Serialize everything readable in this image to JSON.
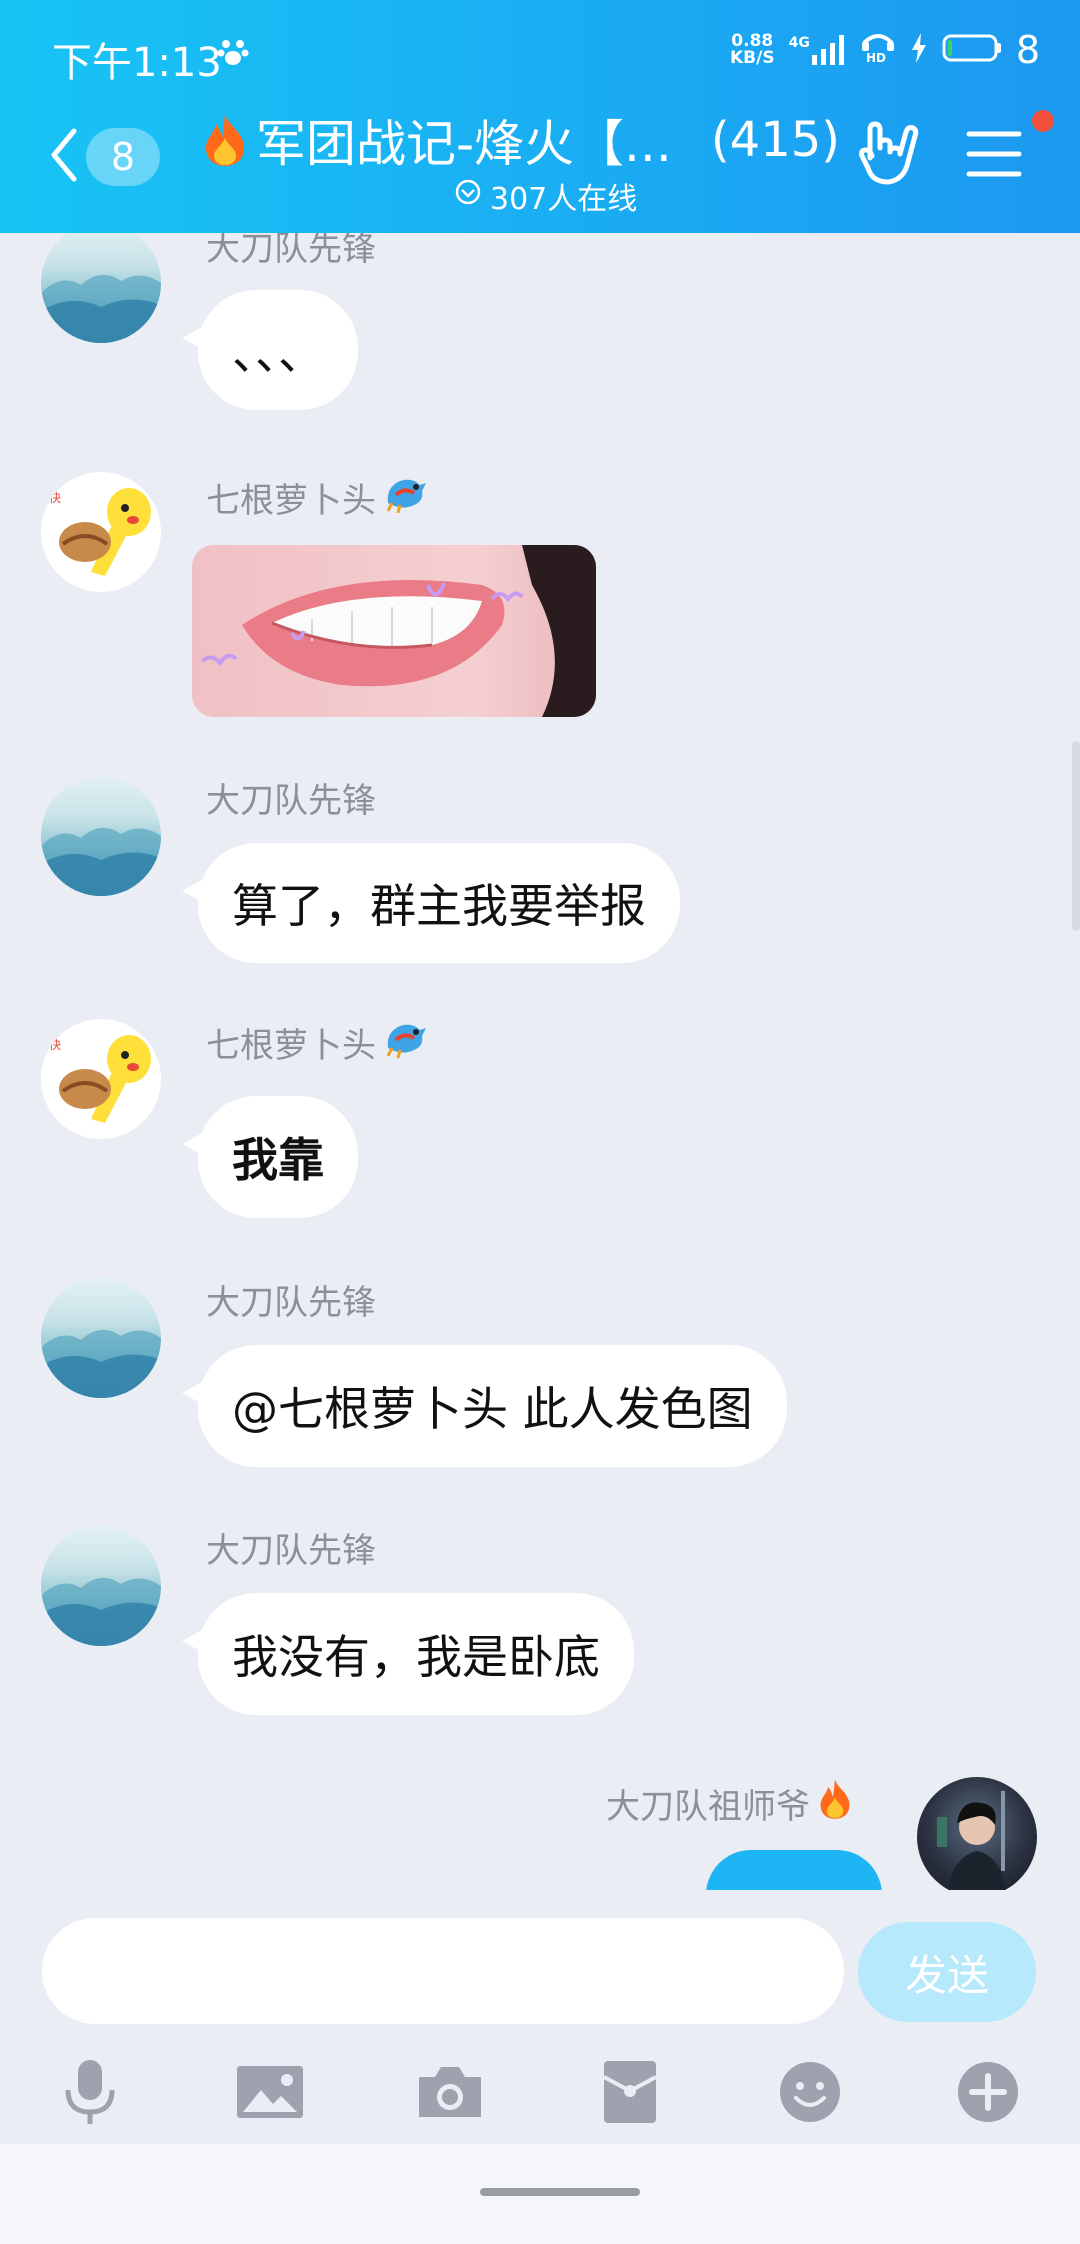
{
  "status_bar": {
    "time": "下午1:13",
    "net_speed_value": "0.88",
    "net_speed_unit": "KB/S",
    "network": "4G",
    "battery": "8"
  },
  "header": {
    "unread_count": "8",
    "group_title": "军团战记-烽火【...",
    "member_count": "(415)",
    "online_text": "307人在线"
  },
  "messages": [
    {
      "sender": "大刀队先锋",
      "text": "、、、"
    },
    {
      "sender": "七根萝卜头",
      "type": "image"
    },
    {
      "sender": "大刀队先锋",
      "text": "算了，群主我要举报"
    },
    {
      "sender": "七根萝卜头",
      "text": "我靠"
    },
    {
      "sender": "大刀队先锋",
      "text": "@七根萝卜头 此人发色图"
    },
    {
      "sender": "大刀队先锋",
      "text": "我没有，我是卧底"
    },
    {
      "sender": "大刀队祖师爷",
      "text": "、"
    }
  ],
  "input": {
    "placeholder": "",
    "send_label": "发送"
  },
  "icons": {
    "accent": "#1aaaf3",
    "tools": [
      "microphone-icon",
      "image-icon",
      "camera-icon",
      "red-packet-icon",
      "emoji-icon",
      "plus-icon"
    ]
  }
}
